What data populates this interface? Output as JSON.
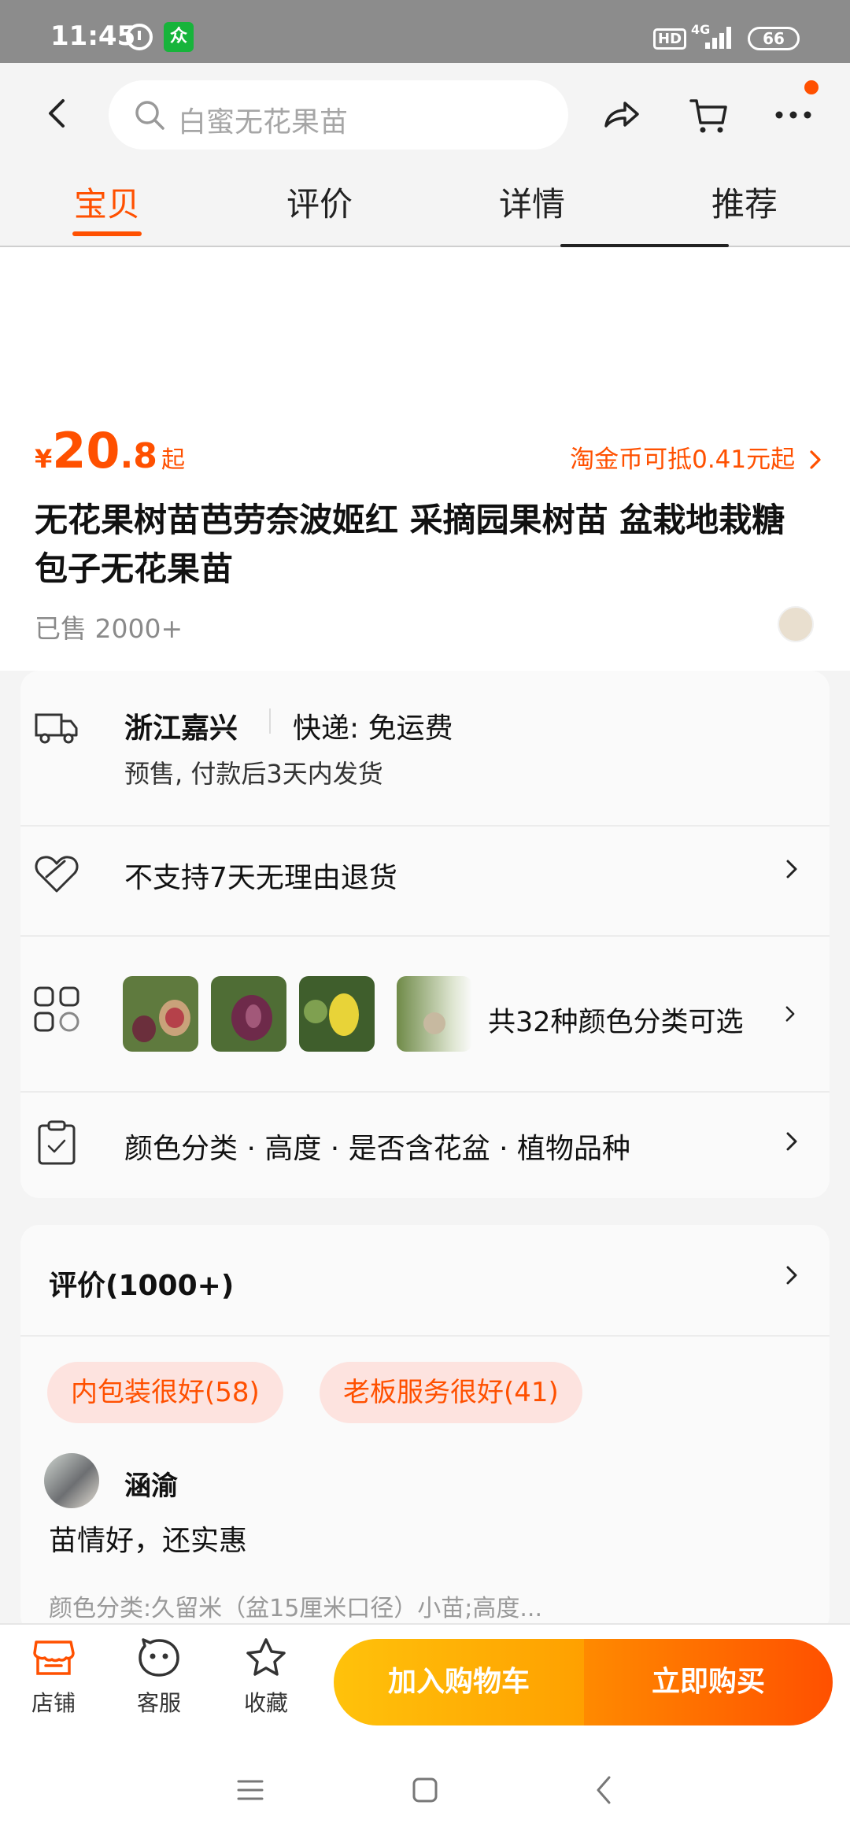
{
  "status_bar": {
    "time": "11:45",
    "network": "4G",
    "hd": "HD",
    "battery": "66"
  },
  "header": {
    "search_placeholder": "白蜜无花果苗",
    "tabs": [
      {
        "label": "宝贝",
        "active": true
      },
      {
        "label": "评价",
        "active": false
      },
      {
        "label": "详情",
        "active": false
      },
      {
        "label": "推荐",
        "active": false
      }
    ]
  },
  "product": {
    "price_currency": "¥",
    "price_integer": "20",
    "price_decimal": ".8",
    "price_suffix": "起",
    "coin_text": "淘金币可抵0.41元起",
    "title": "无花果树苗芭劳奈波姬红 采摘园果树苗 盆栽地栽糖包子无花果苗",
    "sold": "已售 2000+"
  },
  "info_card": {
    "location": "浙江嘉兴",
    "shipping": "快递: 免运费",
    "delivery_note": "预售, 付款后3天内发货",
    "return_policy": "不支持7天无理由退货",
    "variant_count_text": "共32种颜色分类可选",
    "spec_text": "颜色分类 · 高度 · 是否含花盆 · 植物品种"
  },
  "reviews": {
    "title": "评价(1000+)",
    "tags": [
      "内包装很好(58)",
      "老板服务很好(41)"
    ],
    "first": {
      "user": "涵渝",
      "text": "苗情好，还实惠",
      "variant": "颜色分类:久留米（盆15厘米口径）小苗;高度..."
    }
  },
  "bottom_bar": {
    "shop": "店铺",
    "service": "客服",
    "favorite": "收藏",
    "add_cart": "加入购物车",
    "buy_now": "立即购买"
  },
  "colors": {
    "accent": "#ff5000",
    "cart_yellow": "#ffa000",
    "tag_bg": "#fde3df"
  }
}
